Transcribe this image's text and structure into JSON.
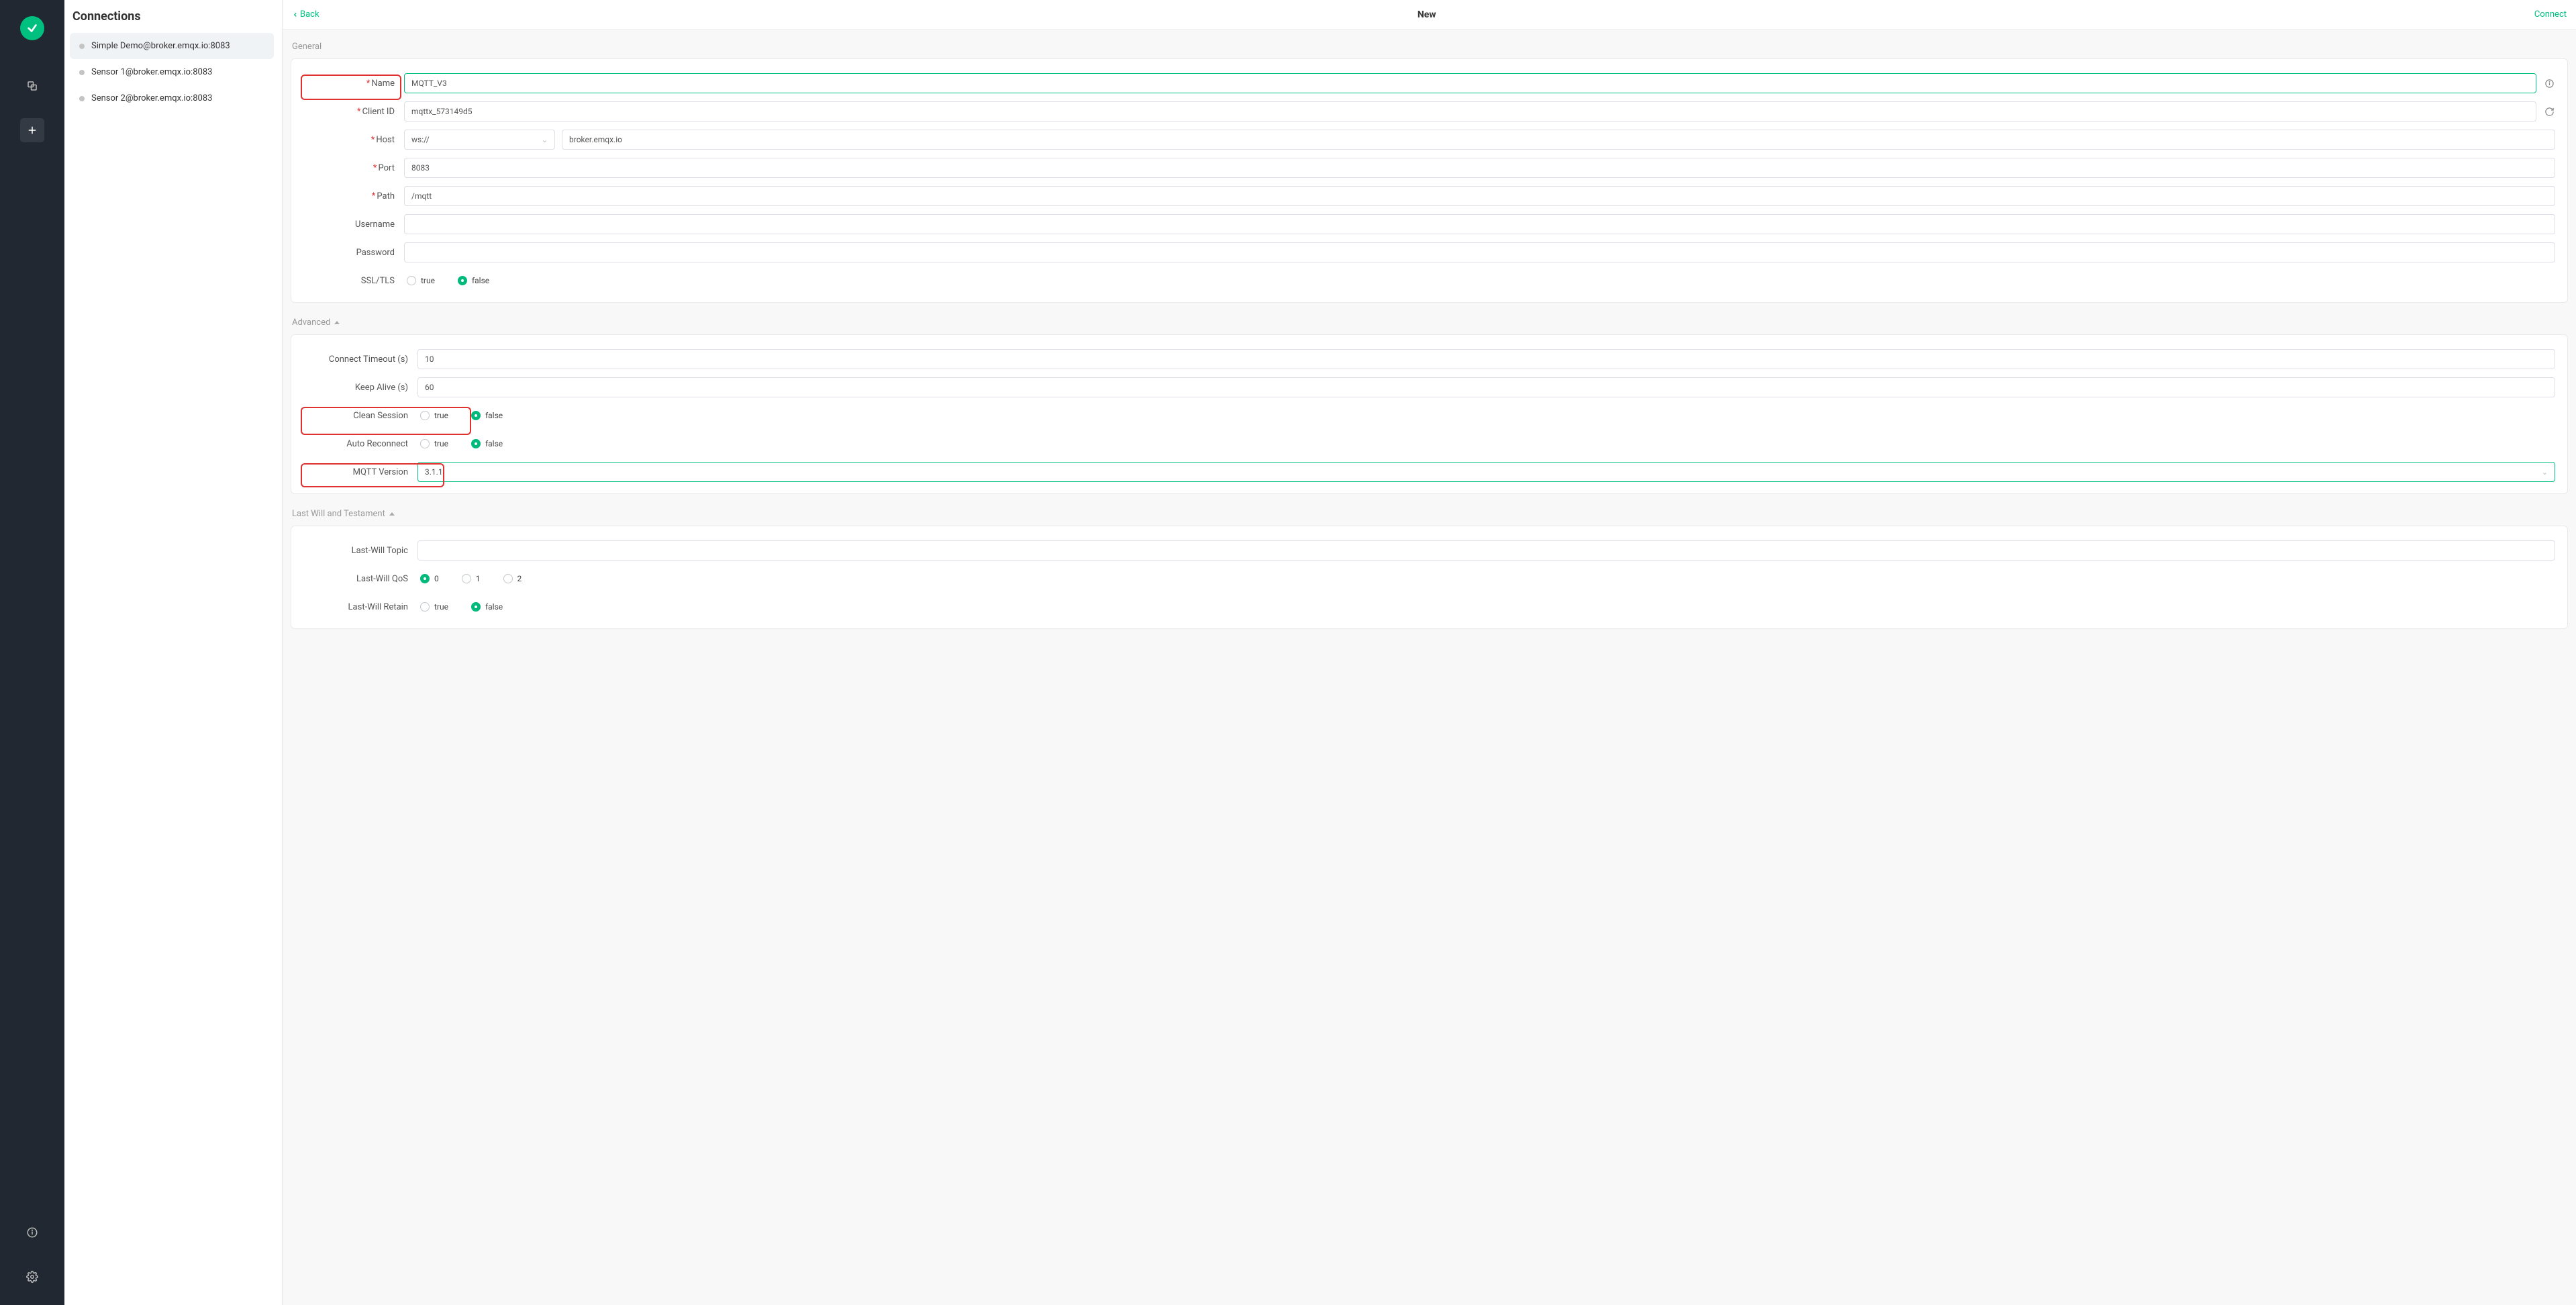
{
  "sidebar": {
    "title": "Connections",
    "items": [
      {
        "label": "Simple Demo@broker.emqx.io:8083",
        "active": true
      },
      {
        "label": "Sensor 1@broker.emqx.io:8083",
        "active": false
      },
      {
        "label": "Sensor 2@broker.emqx.io:8083",
        "active": false
      }
    ]
  },
  "topbar": {
    "back": "Back",
    "title": "New",
    "connect": "Connect"
  },
  "sections": {
    "general": "General",
    "advanced": "Advanced",
    "lastwill": "Last Will and Testament"
  },
  "labels": {
    "name": "Name",
    "client_id": "Client ID",
    "host": "Host",
    "port": "Port",
    "path": "Path",
    "username": "Username",
    "password": "Password",
    "ssl": "SSL/TLS",
    "connect_timeout": "Connect Timeout (s)",
    "keep_alive": "Keep Alive (s)",
    "clean_session": "Clean Session",
    "auto_reconnect": "Auto Reconnect",
    "mqtt_version": "MQTT Version",
    "lw_topic": "Last-Will Topic",
    "lw_qos": "Last-Will QoS",
    "lw_retain": "Last-Will Retain"
  },
  "values": {
    "name": "MQTT_V3",
    "client_id": "mqttx_573149d5",
    "host_scheme": "ws://",
    "host": "broker.emqx.io",
    "port": "8083",
    "path": "/mqtt",
    "username": "",
    "password": "",
    "connect_timeout": "10",
    "keep_alive": "60",
    "mqtt_version": "3.1.1"
  },
  "radios": {
    "true": "true",
    "false": "false",
    "q0": "0",
    "q1": "1",
    "q2": "2"
  }
}
